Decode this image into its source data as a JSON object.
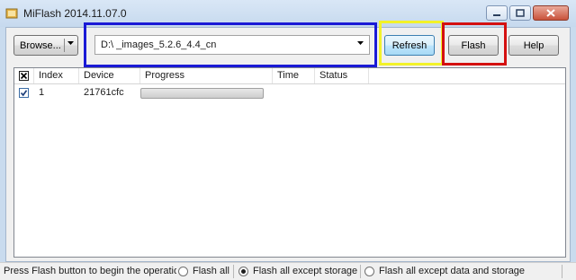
{
  "window": {
    "title": "MiFlash 2014.11.07.0"
  },
  "toolbar": {
    "browse_label": "Browse...",
    "path_value": "D:\\      _images_5.2.6_4.4_cn",
    "refresh_label": "Refresh",
    "flash_label": "Flash",
    "help_label": "Help"
  },
  "highlight_colors": {
    "path": "#1a1ad6",
    "refresh": "#f2f22a",
    "flash": "#d41010"
  },
  "table": {
    "columns": [
      "Index",
      "Device",
      "Progress",
      "Time",
      "Status"
    ],
    "select_all_checked": true,
    "rows": [
      {
        "checked": true,
        "index": "1",
        "device": "21761cfc",
        "progress": 0,
        "time": "",
        "status": ""
      }
    ]
  },
  "statusbar": {
    "message": "Press Flash button to begin the operation",
    "options": [
      {
        "label": "Flash all",
        "selected": false
      },
      {
        "label": "Flash all except storage",
        "selected": true
      },
      {
        "label": "Flash all except data and storage",
        "selected": false
      }
    ]
  }
}
